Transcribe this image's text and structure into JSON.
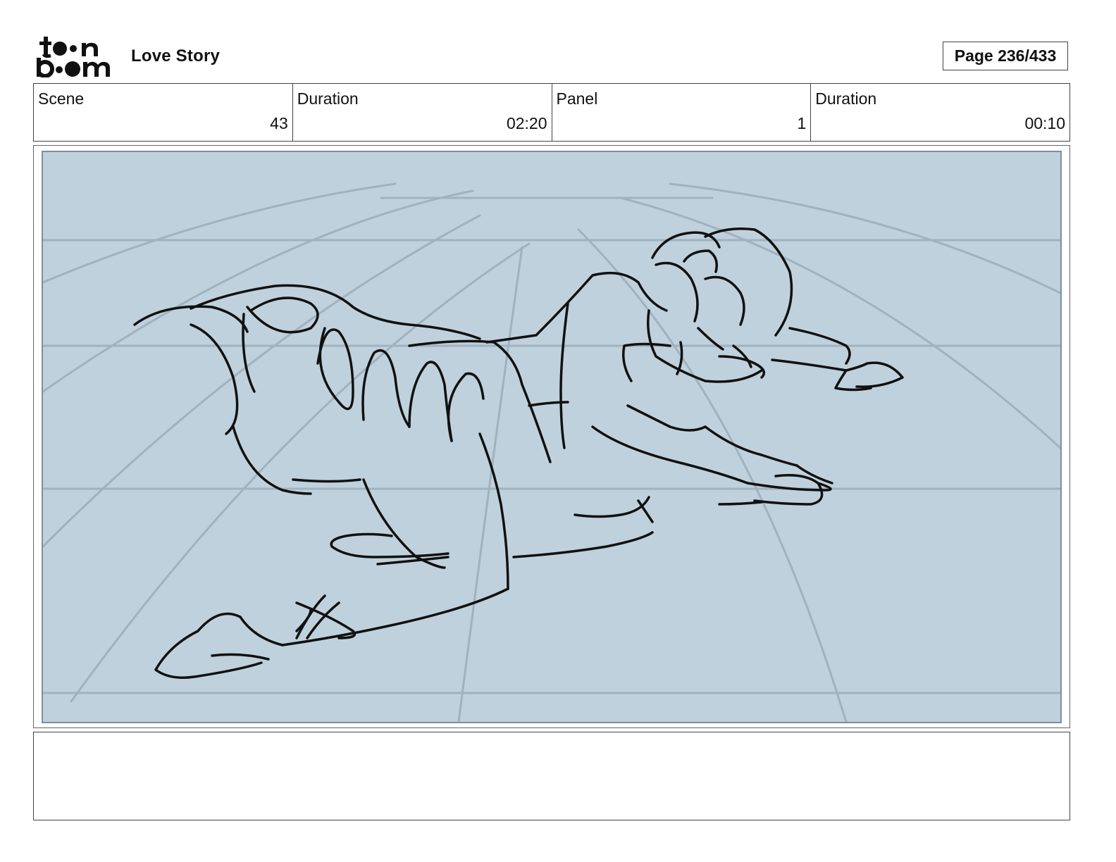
{
  "header": {
    "logo": {
      "top_text": "toon",
      "bottom_text": "boom"
    },
    "project_title": "Love Story",
    "page_indicator": "Page 236/433"
  },
  "info": {
    "scene": {
      "label": "Scene",
      "value": "43"
    },
    "scene_duration": {
      "label": "Duration",
      "value": "02:20"
    },
    "panel": {
      "label": "Panel",
      "value": "1"
    },
    "panel_duration": {
      "label": "Duration",
      "value": "00:10"
    }
  },
  "panel": {
    "background_color": "#bfd1dc",
    "border_color": "#7d8fa0",
    "sketch_color": "#111111",
    "guide_color": "#9fb2be"
  },
  "notes": {
    "text": ""
  }
}
